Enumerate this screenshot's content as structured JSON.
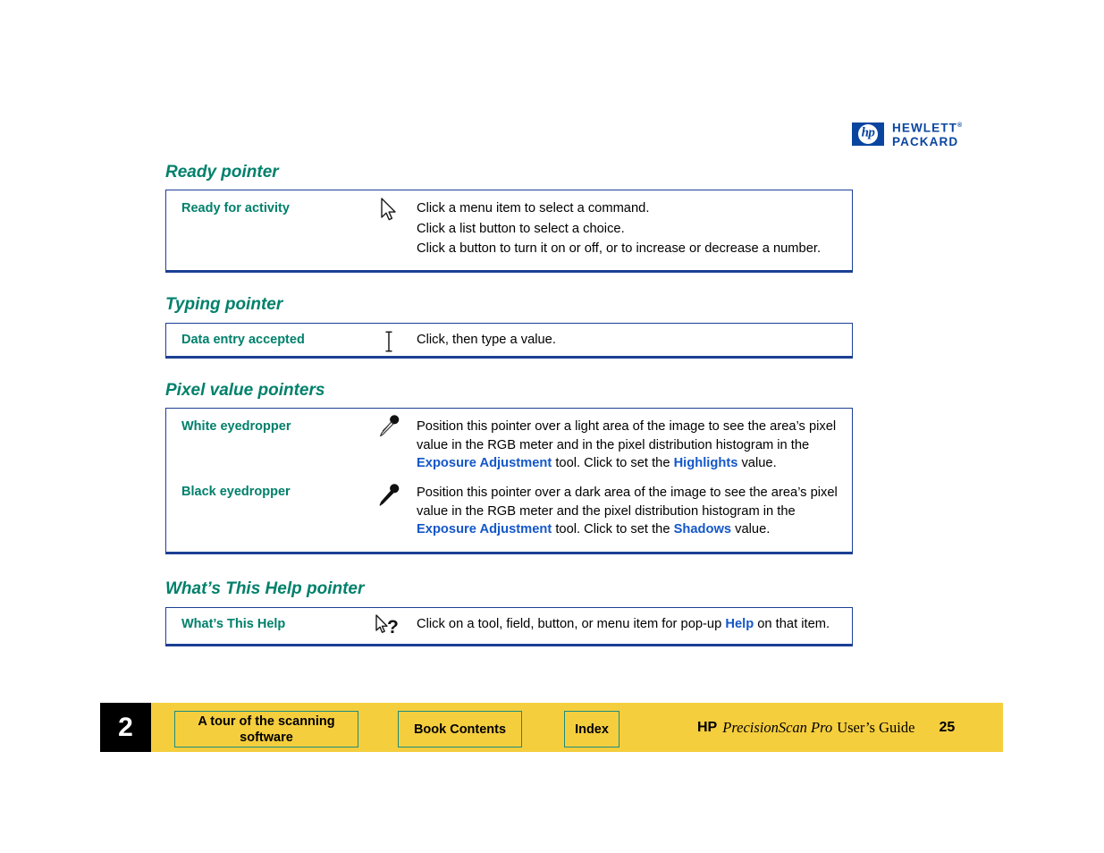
{
  "logo": {
    "mark_text": "hp",
    "line1": "HEWLETT",
    "line2": "PACKARD",
    "trademark": "®",
    "color": "#0A46A0"
  },
  "colors": {
    "heading_teal": "#00806B",
    "table_border_blue": "#1B3F94",
    "link_blue": "#1457C8",
    "footer_gold": "#F5CE3E",
    "button_border_teal": "#1E8C7D"
  },
  "sections": [
    {
      "heading": "Ready pointer",
      "rows": [
        {
          "label": "Ready for activity",
          "icon": "arrow-cursor-icon",
          "lines": [
            [
              {
                "t": "Click a menu item to select a command.",
                "link": false
              }
            ],
            [
              {
                "t": "Click a list button to select a choice.",
                "link": false
              }
            ],
            [
              {
                "t": "Click a button to turn it on or off, or to increase or decrease a number.",
                "link": false
              }
            ]
          ]
        }
      ]
    },
    {
      "heading": "Typing pointer",
      "rows": [
        {
          "label": "Data entry accepted",
          "icon": "i-beam-cursor-icon",
          "lines": [
            [
              {
                "t": "Click, then type a value.",
                "link": false
              }
            ]
          ]
        }
      ]
    },
    {
      "heading": "Pixel value pointers",
      "rows": [
        {
          "label": "White eyedropper",
          "icon": "white-eyedropper-icon",
          "lines": [
            [
              {
                "t": "Position this pointer over a light area of the image to see the area’s pixel value in the RGB meter and in the pixel distribution histogram in the ",
                "link": false
              },
              {
                "t": "Exposure Adjustment",
                "link": true
              },
              {
                "t": " tool. Click to set the ",
                "link": false
              },
              {
                "t": "Highlights",
                "link": true
              },
              {
                "t": " value.",
                "link": false
              }
            ]
          ]
        },
        {
          "label": "Black eyedropper",
          "icon": "black-eyedropper-icon",
          "lines": [
            [
              {
                "t": "Position this pointer over a dark area of the image to see the area’s pixel value in the RGB meter and the pixel distribution histogram in the ",
                "link": false
              },
              {
                "t": "Exposure Adjustment",
                "link": true
              },
              {
                "t": " tool. Click to set the ",
                "link": false
              },
              {
                "t": "Shadows",
                "link": true
              },
              {
                "t": " value.",
                "link": false
              }
            ]
          ]
        }
      ]
    },
    {
      "heading": "What’s This Help pointer",
      "rows": [
        {
          "label": "What’s This Help",
          "icon": "help-cursor-icon",
          "lines": [
            [
              {
                "t": "Click on a tool, field, button, or menu item for pop-up ",
                "link": false
              },
              {
                "t": "Help",
                "link": true
              },
              {
                "t": " on that item.",
                "link": false
              }
            ]
          ]
        }
      ]
    }
  ],
  "footer": {
    "chapter_number": "2",
    "buttons": [
      {
        "id": "tour",
        "label": "A tour of the scanning software"
      },
      {
        "id": "contents",
        "label": "Book Contents"
      },
      {
        "id": "index",
        "label": "Index"
      }
    ],
    "brand": "HP",
    "product": "PrecisionScan Pro",
    "guide": "User’s Guide",
    "page_number": "25"
  }
}
